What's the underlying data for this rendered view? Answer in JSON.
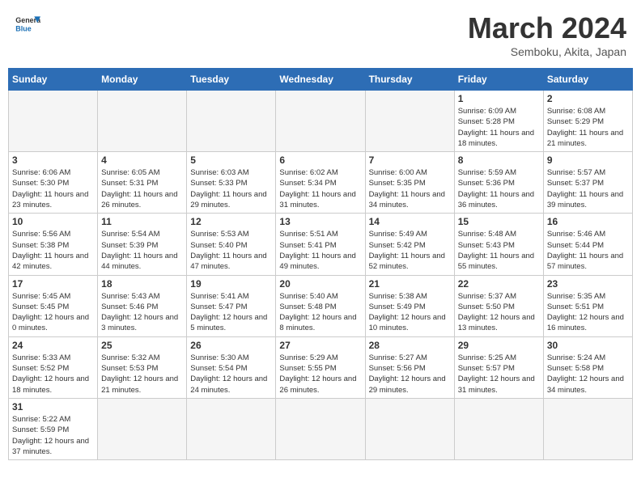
{
  "header": {
    "logo_general": "General",
    "logo_blue": "Blue",
    "month_title": "March 2024",
    "location": "Semboku, Akita, Japan"
  },
  "weekdays": [
    "Sunday",
    "Monday",
    "Tuesday",
    "Wednesday",
    "Thursday",
    "Friday",
    "Saturday"
  ],
  "weeks": [
    [
      {
        "day": "",
        "info": ""
      },
      {
        "day": "",
        "info": ""
      },
      {
        "day": "",
        "info": ""
      },
      {
        "day": "",
        "info": ""
      },
      {
        "day": "",
        "info": ""
      },
      {
        "day": "1",
        "info": "Sunrise: 6:09 AM\nSunset: 5:28 PM\nDaylight: 11 hours and 18 minutes."
      },
      {
        "day": "2",
        "info": "Sunrise: 6:08 AM\nSunset: 5:29 PM\nDaylight: 11 hours and 21 minutes."
      }
    ],
    [
      {
        "day": "3",
        "info": "Sunrise: 6:06 AM\nSunset: 5:30 PM\nDaylight: 11 hours and 23 minutes."
      },
      {
        "day": "4",
        "info": "Sunrise: 6:05 AM\nSunset: 5:31 PM\nDaylight: 11 hours and 26 minutes."
      },
      {
        "day": "5",
        "info": "Sunrise: 6:03 AM\nSunset: 5:33 PM\nDaylight: 11 hours and 29 minutes."
      },
      {
        "day": "6",
        "info": "Sunrise: 6:02 AM\nSunset: 5:34 PM\nDaylight: 11 hours and 31 minutes."
      },
      {
        "day": "7",
        "info": "Sunrise: 6:00 AM\nSunset: 5:35 PM\nDaylight: 11 hours and 34 minutes."
      },
      {
        "day": "8",
        "info": "Sunrise: 5:59 AM\nSunset: 5:36 PM\nDaylight: 11 hours and 36 minutes."
      },
      {
        "day": "9",
        "info": "Sunrise: 5:57 AM\nSunset: 5:37 PM\nDaylight: 11 hours and 39 minutes."
      }
    ],
    [
      {
        "day": "10",
        "info": "Sunrise: 5:56 AM\nSunset: 5:38 PM\nDaylight: 11 hours and 42 minutes."
      },
      {
        "day": "11",
        "info": "Sunrise: 5:54 AM\nSunset: 5:39 PM\nDaylight: 11 hours and 44 minutes."
      },
      {
        "day": "12",
        "info": "Sunrise: 5:53 AM\nSunset: 5:40 PM\nDaylight: 11 hours and 47 minutes."
      },
      {
        "day": "13",
        "info": "Sunrise: 5:51 AM\nSunset: 5:41 PM\nDaylight: 11 hours and 49 minutes."
      },
      {
        "day": "14",
        "info": "Sunrise: 5:49 AM\nSunset: 5:42 PM\nDaylight: 11 hours and 52 minutes."
      },
      {
        "day": "15",
        "info": "Sunrise: 5:48 AM\nSunset: 5:43 PM\nDaylight: 11 hours and 55 minutes."
      },
      {
        "day": "16",
        "info": "Sunrise: 5:46 AM\nSunset: 5:44 PM\nDaylight: 11 hours and 57 minutes."
      }
    ],
    [
      {
        "day": "17",
        "info": "Sunrise: 5:45 AM\nSunset: 5:45 PM\nDaylight: 12 hours and 0 minutes."
      },
      {
        "day": "18",
        "info": "Sunrise: 5:43 AM\nSunset: 5:46 PM\nDaylight: 12 hours and 3 minutes."
      },
      {
        "day": "19",
        "info": "Sunrise: 5:41 AM\nSunset: 5:47 PM\nDaylight: 12 hours and 5 minutes."
      },
      {
        "day": "20",
        "info": "Sunrise: 5:40 AM\nSunset: 5:48 PM\nDaylight: 12 hours and 8 minutes."
      },
      {
        "day": "21",
        "info": "Sunrise: 5:38 AM\nSunset: 5:49 PM\nDaylight: 12 hours and 10 minutes."
      },
      {
        "day": "22",
        "info": "Sunrise: 5:37 AM\nSunset: 5:50 PM\nDaylight: 12 hours and 13 minutes."
      },
      {
        "day": "23",
        "info": "Sunrise: 5:35 AM\nSunset: 5:51 PM\nDaylight: 12 hours and 16 minutes."
      }
    ],
    [
      {
        "day": "24",
        "info": "Sunrise: 5:33 AM\nSunset: 5:52 PM\nDaylight: 12 hours and 18 minutes."
      },
      {
        "day": "25",
        "info": "Sunrise: 5:32 AM\nSunset: 5:53 PM\nDaylight: 12 hours and 21 minutes."
      },
      {
        "day": "26",
        "info": "Sunrise: 5:30 AM\nSunset: 5:54 PM\nDaylight: 12 hours and 24 minutes."
      },
      {
        "day": "27",
        "info": "Sunrise: 5:29 AM\nSunset: 5:55 PM\nDaylight: 12 hours and 26 minutes."
      },
      {
        "day": "28",
        "info": "Sunrise: 5:27 AM\nSunset: 5:56 PM\nDaylight: 12 hours and 29 minutes."
      },
      {
        "day": "29",
        "info": "Sunrise: 5:25 AM\nSunset: 5:57 PM\nDaylight: 12 hours and 31 minutes."
      },
      {
        "day": "30",
        "info": "Sunrise: 5:24 AM\nSunset: 5:58 PM\nDaylight: 12 hours and 34 minutes."
      }
    ],
    [
      {
        "day": "31",
        "info": "Sunrise: 5:22 AM\nSunset: 5:59 PM\nDaylight: 12 hours and 37 minutes."
      },
      {
        "day": "",
        "info": ""
      },
      {
        "day": "",
        "info": ""
      },
      {
        "day": "",
        "info": ""
      },
      {
        "day": "",
        "info": ""
      },
      {
        "day": "",
        "info": ""
      },
      {
        "day": "",
        "info": ""
      }
    ]
  ]
}
